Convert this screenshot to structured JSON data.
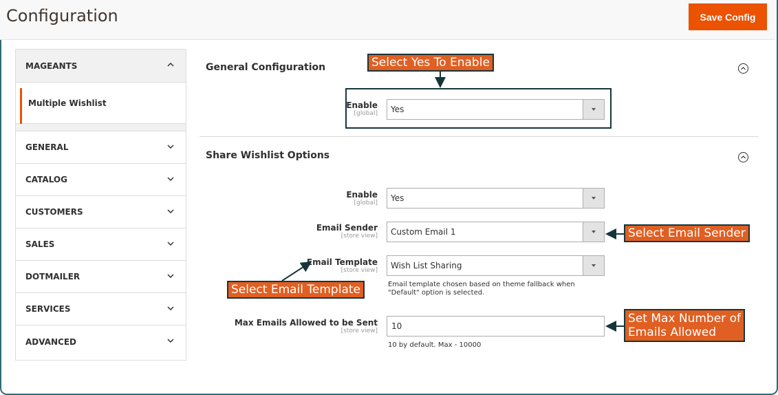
{
  "header": {
    "title": "Configuration",
    "save_label": "Save Config"
  },
  "sidebar": {
    "head": "MAGEANTS",
    "sub_item": "Multiple Wishlist",
    "groups": [
      "GENERAL",
      "CATALOG",
      "CUSTOMERS",
      "SALES",
      "DOTMAILER",
      "SERVICES",
      "ADVANCED"
    ]
  },
  "general": {
    "title": "General Configuration",
    "enable": {
      "label": "Enable",
      "scope": "[global]",
      "value": "Yes"
    }
  },
  "share": {
    "title": "Share Wishlist Options",
    "enable": {
      "label": "Enable",
      "scope": "[global]",
      "value": "Yes"
    },
    "sender": {
      "label": "Email Sender",
      "scope": "[store view]",
      "value": "Custom Email 1"
    },
    "template": {
      "label": "Email Template",
      "scope": "[store view]",
      "value": "Wish List Sharing",
      "note_1": "Email template chosen based on theme fallback when",
      "note_2": "\"Default\" option is selected."
    },
    "max": {
      "label": "Max Emails Allowed to be Sent",
      "scope": "[store view]",
      "value": "10",
      "note": "10 by default. Max - 10000"
    }
  },
  "annotations": {
    "enable": "Select Yes To Enable",
    "sender": "Select Email Sender",
    "template": "Select Email Template",
    "max_1": "Set Max Number of",
    "max_2": "Emails Allowed"
  },
  "colors": {
    "accent": "#eb5202",
    "callout": "#e05f22",
    "callout_border": "#16353b",
    "frame": "#2d6b75"
  }
}
